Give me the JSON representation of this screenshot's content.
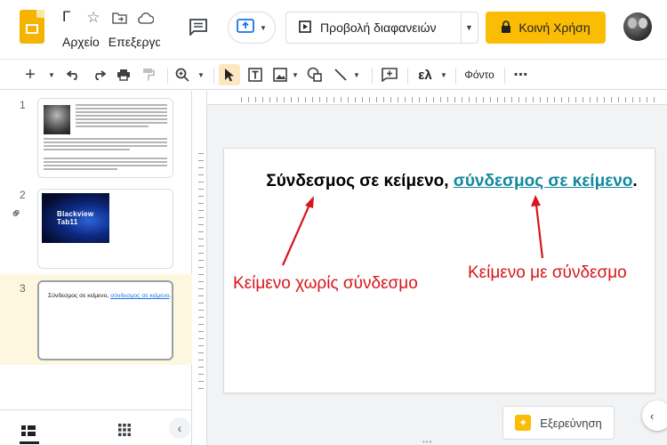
{
  "app": {
    "title": "Γ",
    "menu": [
      "Αρχείο",
      "Επεξεργασία"
    ]
  },
  "header": {
    "present_label": "Προβολή διαφανειών",
    "share_label": "Κοινή Χρήση"
  },
  "toolbar": {
    "input_tools_label": "ελ",
    "background_label": "Φόντο"
  },
  "slides": [
    {
      "number": "1"
    },
    {
      "number": "2",
      "image_caption": "Blackview Tab11"
    },
    {
      "number": "3",
      "text_plain": "Σύνδεσμος σε κείμενο, ",
      "text_link": "σύνδεσμος σε κείμενο",
      "text_end": "."
    }
  ],
  "slide": {
    "text_plain": "Σύνδεσμος σε κείμενο, ",
    "text_link": "σύνδεσμος σε κείμενο",
    "text_end": ".",
    "annotation_left": "Κείμενο χωρίς σύνδεσμο",
    "annotation_right": "Κείμενο με σύνδεσμο"
  },
  "explore": {
    "label": "Εξερεύνηση"
  },
  "colors": {
    "brand_yellow": "#fbbc04",
    "link_teal": "#12899c",
    "annotation_red": "#d8151b",
    "active_slide_bg": "#fef7e0"
  },
  "icons": {
    "header": [
      "slides-logo",
      "star-icon",
      "move-folder-icon",
      "cloud-status-icon",
      "comment-icon",
      "present-icon",
      "play-icon",
      "lock-icon",
      "avatar"
    ],
    "toolbar": [
      "plus-icon",
      "undo-icon",
      "redo-icon",
      "print-icon",
      "paint-format-icon",
      "zoom-icon",
      "select-icon",
      "text-box-icon",
      "image-icon",
      "shape-icon",
      "line-icon",
      "add-comment-icon",
      "more-icon"
    ]
  }
}
